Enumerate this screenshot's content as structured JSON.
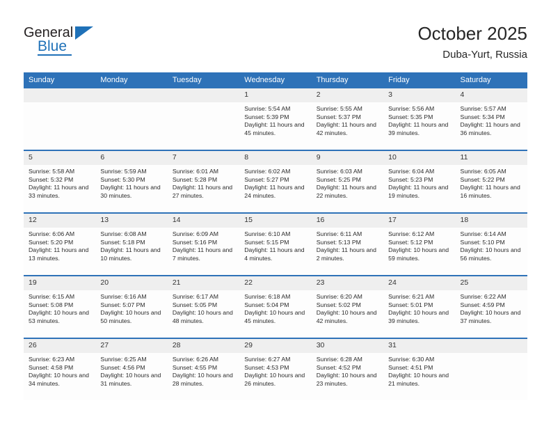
{
  "brand": {
    "name_part1": "General",
    "name_part2": "Blue",
    "triangle_icon": "triangle-icon",
    "accent_color": "#1f71b8"
  },
  "header": {
    "month_title": "October 2025",
    "location": "Duba-Yurt, Russia"
  },
  "theme": {
    "header_blue": "#2e72b8",
    "cell_header_gray": "#efefef",
    "cell_body": "#fdfdfd",
    "text": "#2b2b2b"
  },
  "calendar": {
    "weekday_headers": [
      "Sunday",
      "Monday",
      "Tuesday",
      "Wednesday",
      "Thursday",
      "Friday",
      "Saturday"
    ],
    "weeks": [
      [
        {
          "day": "",
          "sunrise": "",
          "sunset": "",
          "daylight": "",
          "empty": true
        },
        {
          "day": "",
          "sunrise": "",
          "sunset": "",
          "daylight": "",
          "empty": true
        },
        {
          "day": "",
          "sunrise": "",
          "sunset": "",
          "daylight": "",
          "empty": true
        },
        {
          "day": "1",
          "sunrise": "Sunrise: 5:54 AM",
          "sunset": "Sunset: 5:39 PM",
          "daylight": "Daylight: 11 hours and 45 minutes."
        },
        {
          "day": "2",
          "sunrise": "Sunrise: 5:55 AM",
          "sunset": "Sunset: 5:37 PM",
          "daylight": "Daylight: 11 hours and 42 minutes."
        },
        {
          "day": "3",
          "sunrise": "Sunrise: 5:56 AM",
          "sunset": "Sunset: 5:35 PM",
          "daylight": "Daylight: 11 hours and 39 minutes."
        },
        {
          "day": "4",
          "sunrise": "Sunrise: 5:57 AM",
          "sunset": "Sunset: 5:34 PM",
          "daylight": "Daylight: 11 hours and 36 minutes."
        }
      ],
      [
        {
          "day": "5",
          "sunrise": "Sunrise: 5:58 AM",
          "sunset": "Sunset: 5:32 PM",
          "daylight": "Daylight: 11 hours and 33 minutes."
        },
        {
          "day": "6",
          "sunrise": "Sunrise: 5:59 AM",
          "sunset": "Sunset: 5:30 PM",
          "daylight": "Daylight: 11 hours and 30 minutes."
        },
        {
          "day": "7",
          "sunrise": "Sunrise: 6:01 AM",
          "sunset": "Sunset: 5:28 PM",
          "daylight": "Daylight: 11 hours and 27 minutes."
        },
        {
          "day": "8",
          "sunrise": "Sunrise: 6:02 AM",
          "sunset": "Sunset: 5:27 PM",
          "daylight": "Daylight: 11 hours and 24 minutes."
        },
        {
          "day": "9",
          "sunrise": "Sunrise: 6:03 AM",
          "sunset": "Sunset: 5:25 PM",
          "daylight": "Daylight: 11 hours and 22 minutes."
        },
        {
          "day": "10",
          "sunrise": "Sunrise: 6:04 AM",
          "sunset": "Sunset: 5:23 PM",
          "daylight": "Daylight: 11 hours and 19 minutes."
        },
        {
          "day": "11",
          "sunrise": "Sunrise: 6:05 AM",
          "sunset": "Sunset: 5:22 PM",
          "daylight": "Daylight: 11 hours and 16 minutes."
        }
      ],
      [
        {
          "day": "12",
          "sunrise": "Sunrise: 6:06 AM",
          "sunset": "Sunset: 5:20 PM",
          "daylight": "Daylight: 11 hours and 13 minutes."
        },
        {
          "day": "13",
          "sunrise": "Sunrise: 6:08 AM",
          "sunset": "Sunset: 5:18 PM",
          "daylight": "Daylight: 11 hours and 10 minutes."
        },
        {
          "day": "14",
          "sunrise": "Sunrise: 6:09 AM",
          "sunset": "Sunset: 5:16 PM",
          "daylight": "Daylight: 11 hours and 7 minutes."
        },
        {
          "day": "15",
          "sunrise": "Sunrise: 6:10 AM",
          "sunset": "Sunset: 5:15 PM",
          "daylight": "Daylight: 11 hours and 4 minutes."
        },
        {
          "day": "16",
          "sunrise": "Sunrise: 6:11 AM",
          "sunset": "Sunset: 5:13 PM",
          "daylight": "Daylight: 11 hours and 2 minutes."
        },
        {
          "day": "17",
          "sunrise": "Sunrise: 6:12 AM",
          "sunset": "Sunset: 5:12 PM",
          "daylight": "Daylight: 10 hours and 59 minutes."
        },
        {
          "day": "18",
          "sunrise": "Sunrise: 6:14 AM",
          "sunset": "Sunset: 5:10 PM",
          "daylight": "Daylight: 10 hours and 56 minutes."
        }
      ],
      [
        {
          "day": "19",
          "sunrise": "Sunrise: 6:15 AM",
          "sunset": "Sunset: 5:08 PM",
          "daylight": "Daylight: 10 hours and 53 minutes."
        },
        {
          "day": "20",
          "sunrise": "Sunrise: 6:16 AM",
          "sunset": "Sunset: 5:07 PM",
          "daylight": "Daylight: 10 hours and 50 minutes."
        },
        {
          "day": "21",
          "sunrise": "Sunrise: 6:17 AM",
          "sunset": "Sunset: 5:05 PM",
          "daylight": "Daylight: 10 hours and 48 minutes."
        },
        {
          "day": "22",
          "sunrise": "Sunrise: 6:18 AM",
          "sunset": "Sunset: 5:04 PM",
          "daylight": "Daylight: 10 hours and 45 minutes."
        },
        {
          "day": "23",
          "sunrise": "Sunrise: 6:20 AM",
          "sunset": "Sunset: 5:02 PM",
          "daylight": "Daylight: 10 hours and 42 minutes."
        },
        {
          "day": "24",
          "sunrise": "Sunrise: 6:21 AM",
          "sunset": "Sunset: 5:01 PM",
          "daylight": "Daylight: 10 hours and 39 minutes."
        },
        {
          "day": "25",
          "sunrise": "Sunrise: 6:22 AM",
          "sunset": "Sunset: 4:59 PM",
          "daylight": "Daylight: 10 hours and 37 minutes."
        }
      ],
      [
        {
          "day": "26",
          "sunrise": "Sunrise: 6:23 AM",
          "sunset": "Sunset: 4:58 PM",
          "daylight": "Daylight: 10 hours and 34 minutes."
        },
        {
          "day": "27",
          "sunrise": "Sunrise: 6:25 AM",
          "sunset": "Sunset: 4:56 PM",
          "daylight": "Daylight: 10 hours and 31 minutes."
        },
        {
          "day": "28",
          "sunrise": "Sunrise: 6:26 AM",
          "sunset": "Sunset: 4:55 PM",
          "daylight": "Daylight: 10 hours and 28 minutes."
        },
        {
          "day": "29",
          "sunrise": "Sunrise: 6:27 AM",
          "sunset": "Sunset: 4:53 PM",
          "daylight": "Daylight: 10 hours and 26 minutes."
        },
        {
          "day": "30",
          "sunrise": "Sunrise: 6:28 AM",
          "sunset": "Sunset: 4:52 PM",
          "daylight": "Daylight: 10 hours and 23 minutes."
        },
        {
          "day": "31",
          "sunrise": "Sunrise: 6:30 AM",
          "sunset": "Sunset: 4:51 PM",
          "daylight": "Daylight: 10 hours and 21 minutes."
        },
        {
          "day": "",
          "sunrise": "",
          "sunset": "",
          "daylight": "",
          "empty": true
        }
      ]
    ]
  }
}
